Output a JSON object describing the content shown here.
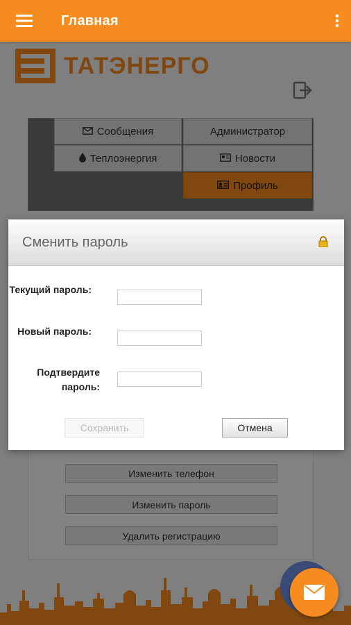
{
  "appbar": {
    "title": "Главная",
    "menu_icon": "hamburger-icon",
    "more_icon": "more-vert-icon"
  },
  "brand": {
    "name": "ТАТЭНЕРГО",
    "color": "#f68b1f"
  },
  "menu": {
    "items": [
      {
        "label": "Сообщения",
        "icon": "envelope-icon"
      },
      {
        "label": "Администратор",
        "icon": ""
      },
      {
        "label": "Теплоэнергия",
        "icon": "drop-icon"
      },
      {
        "label": "Новости",
        "icon": "newspaper-icon"
      },
      {
        "label": "Профиль",
        "icon": "id-card-icon",
        "active": true
      }
    ]
  },
  "profile_actions": [
    {
      "label": "Изменить телефон"
    },
    {
      "label": "Изменить пароль"
    },
    {
      "label": "Удалить регистрацию"
    }
  ],
  "dialog": {
    "title": "Сменить пароль",
    "fields": [
      {
        "label": "Текущий пароль:",
        "value": "",
        "placeholder": ""
      },
      {
        "label": "Новый пароль:",
        "value": "",
        "placeholder": ""
      },
      {
        "label": "Подтвердите пароль:",
        "value": "",
        "placeholder": ""
      }
    ],
    "save_label": "Сохранить",
    "cancel_label": "Отмена"
  },
  "colors": {
    "accent": "#f68b1f",
    "overlay": "rgba(0,0,0,0.48)"
  }
}
